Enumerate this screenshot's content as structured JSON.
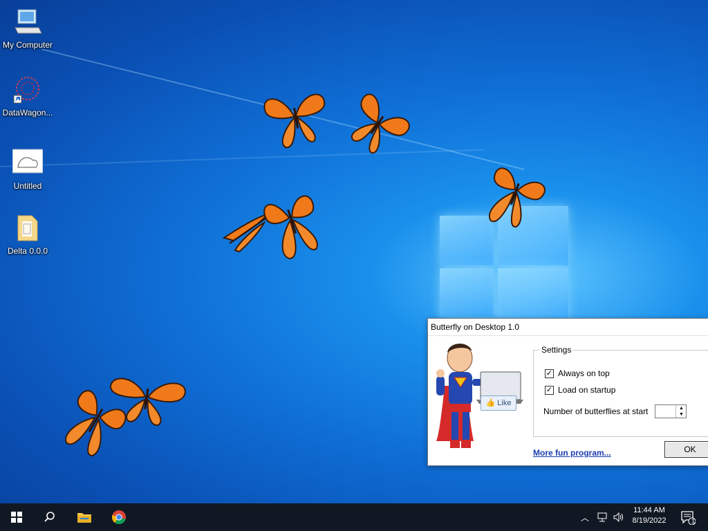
{
  "desktop": {
    "icons": [
      {
        "label": "My Computer",
        "icon": "computer-icon"
      },
      {
        "label": "DataWagon...",
        "icon": "datawagon-shortcut-icon"
      },
      {
        "label": "Untitled",
        "icon": "image-file-icon"
      },
      {
        "label": "Delta 0.0.0",
        "icon": "folder-icon"
      }
    ]
  },
  "dialog": {
    "title": "Butterfly on Desktop 1.0",
    "group_title": "Settings",
    "always_on_top": {
      "label": "Always on top",
      "checked": true
    },
    "load_on_startup": {
      "label": "Load on startup",
      "checked": true
    },
    "butterflies_label": "Number of butterflies at start",
    "butterflies_value": "",
    "more_link": "More fun program...",
    "ok_label": "OK",
    "like_label": "Like"
  },
  "taskbar": {
    "start": "windows-start-icon",
    "search": "search-icon",
    "file_explorer": "file-explorer-icon",
    "chrome": "chrome-icon",
    "tray": {
      "time": "11:44 AM",
      "date": "8/19/2022",
      "notification_count": "1"
    }
  },
  "colors": {
    "butterfly_orange": "#f07a1a",
    "taskbar": "#101823",
    "link": "#1a3cb0"
  }
}
